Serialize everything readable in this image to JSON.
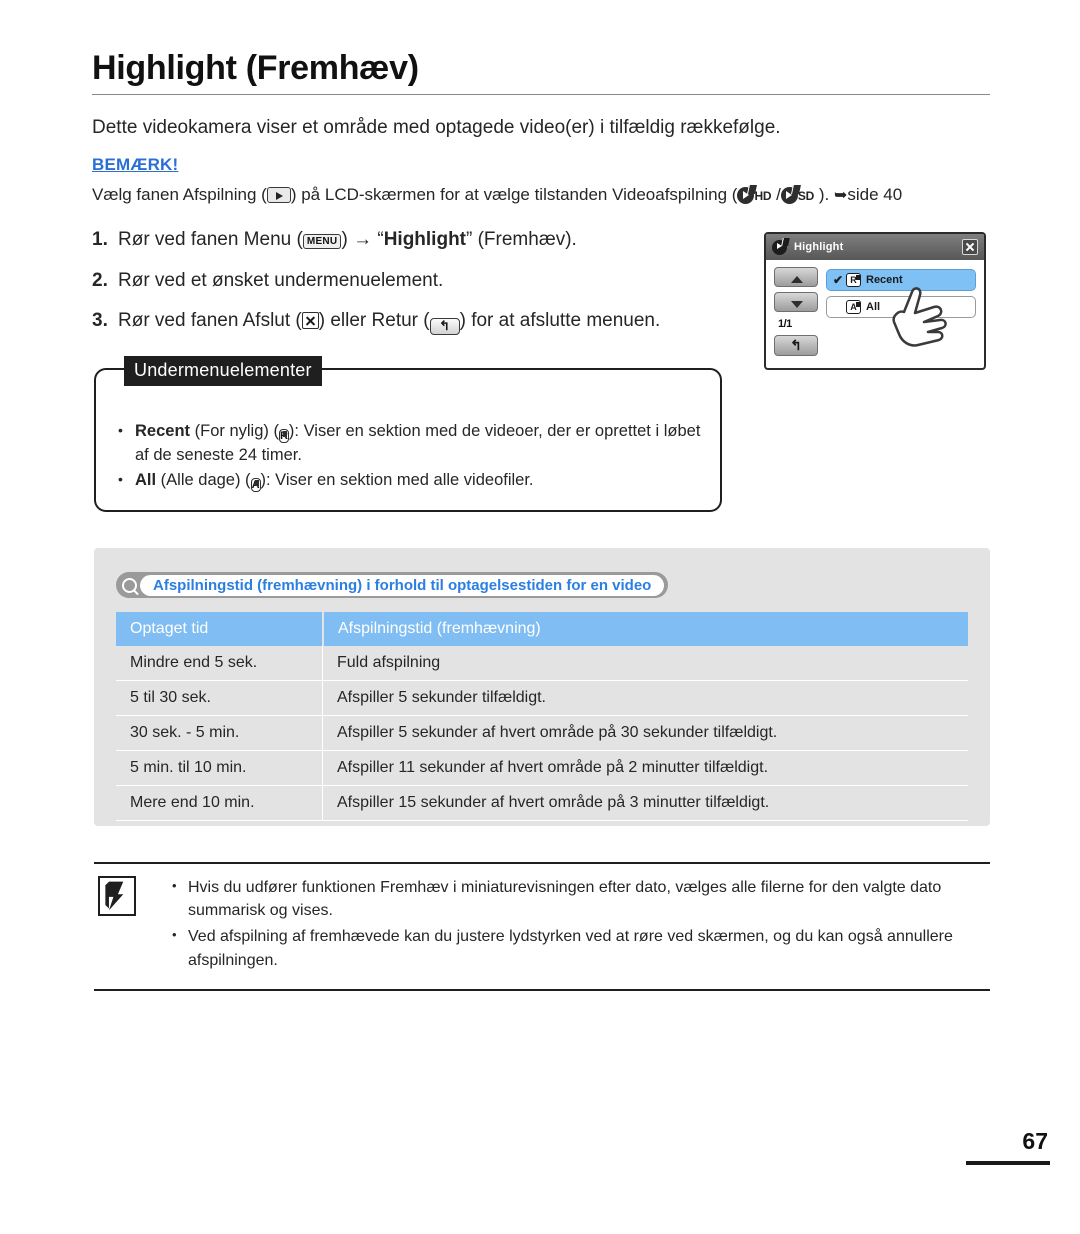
{
  "document": {
    "title": "Highlight (Fremhæv)",
    "intro": "Dette videokamera viser et område med optagede video(er) i tilfældig rækkefølge.",
    "page_number": "67"
  },
  "notice": {
    "heading": "BEMÆRK!",
    "text_part1": "Vælg fanen Afspilning (",
    "text_part2": ") på LCD-skærmen for at vælge tilstanden Videoafspilning (",
    "hd_label": "HD",
    "sd_separator": " /",
    "sd_label": "SD",
    "text_part3": " ).",
    "arrow": "➥",
    "page_ref": "side 40",
    "play_tab_icon": "play-tab-icon"
  },
  "steps": [
    {
      "num": "1.",
      "pre": "Rør ved fanen Menu (",
      "icon_label": "MENU",
      "mid": ")",
      "arrow": "→",
      "quote_open": "“",
      "bold": "Highlight",
      "quote_close": "”",
      "post": " (Fremhæv)."
    },
    {
      "num": "2.",
      "text": "Rør ved et ønsket undermenuelement."
    },
    {
      "num": "3.",
      "pre": "Rør ved fanen Afslut (",
      "mid": ") eller Retur (",
      "return_glyph": "↰",
      "post": ") for at afslutte menuen."
    }
  ],
  "lcd": {
    "title": "Highlight",
    "close_icon": "close-icon",
    "page_indicator": "1/1",
    "scroll_up_icon": "chevron-up-icon",
    "scroll_down_icon": "chevron-down-icon",
    "return_glyph": "↰",
    "items": [
      {
        "check": "✔",
        "badge": "R",
        "label": "Recent",
        "selected": true
      },
      {
        "check": "",
        "badge": "A",
        "label": "All",
        "selected": false
      }
    ],
    "hand_cursor": "hand-pointer-icon"
  },
  "submenu": {
    "tag": "Undermenuelementer",
    "items": [
      {
        "bullet": "•",
        "name": "Recent",
        "translation": " (For nylig) (",
        "badge": "R",
        "rest": "): Viser en sektion med de videoer, der er oprettet i løbet af de seneste 24 timer."
      },
      {
        "bullet": "•",
        "name": "All",
        "translation": " (Alle dage) (",
        "badge": "A",
        "rest": "): Viser en sektion med alle videofiler."
      }
    ]
  },
  "table_section": {
    "search_icon": "magnifier-icon",
    "caption": "Afspilningstid (fremhævning) i forhold til optagelsestiden for en video",
    "columns": [
      "Optaget tid",
      "Afspilningstid (fremhævning)"
    ],
    "rows": [
      [
        "Mindre end 5 sek.",
        "Fuld afspilning"
      ],
      [
        "5 til 30 sek.",
        "Afspiller 5 sekunder tilfældigt."
      ],
      [
        "30 sek. - 5 min.",
        "Afspiller 5 sekunder af hvert område på 30 sekunder tilfældigt."
      ],
      [
        "5 min. til 10 min.",
        "Afspiller 11 sekunder af hvert område på 2 minutter tilfældigt."
      ],
      [
        "Mere end 10 min.",
        "Afspiller 15 sekunder af hvert område på 3 minutter tilfældigt."
      ]
    ]
  },
  "footer_notes": {
    "icon": "note-pen-icon",
    "items": [
      {
        "bullet": "•",
        "text": "Hvis du udfører funktionen Fremhæv i miniaturevisningen efter dato, vælges alle filerne for den valgte dato summarisk og vises."
      },
      {
        "bullet": "•",
        "text": "Ved afspilning af fremhævede kan du justere lydstyrken ved at røre ved skærmen, og du kan også annullere afspilningen."
      }
    ]
  },
  "colors": {
    "notice_blue": "#2b6fd4",
    "caption_blue": "#2b7fe0",
    "table_header_blue": "#7fbdf3",
    "lcd_selected_blue": "#7fc0f5",
    "panel_gray": "#e3e3e3"
  }
}
